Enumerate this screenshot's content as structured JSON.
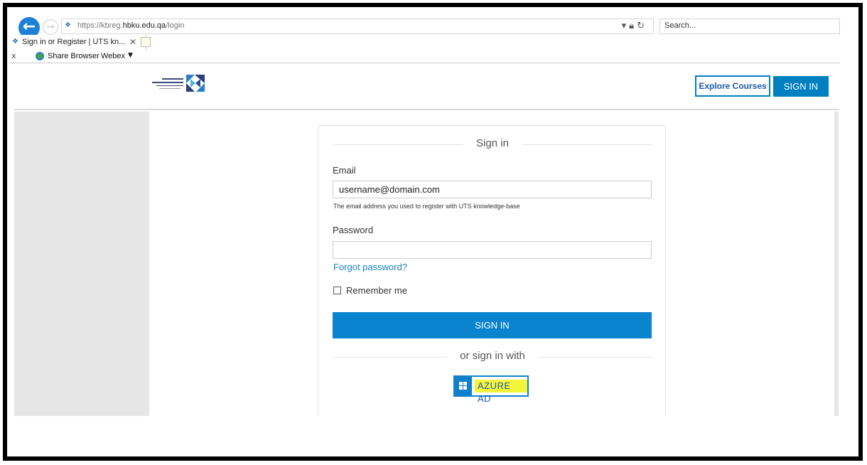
{
  "browser": {
    "url_prefix": "https://kbreg.",
    "url_host": "hbku.edu.qa",
    "url_path": "/login",
    "search_placeholder": "Search...",
    "tab_title": "Sign in or Register | UTS kn...",
    "favorites": {
      "close_glyph": "x",
      "share_browser": "Share Browser",
      "webex": "Webex"
    }
  },
  "header": {
    "explore_courses": "Explore Courses",
    "sign_in": "SIGN IN"
  },
  "form": {
    "title": "Sign in",
    "email_label": "Email",
    "email_value": "username@domain.com",
    "email_help": "The email address you used to register with UTS knowledge-base",
    "password_label": "Password",
    "password_value": "",
    "forgot_password": "Forgot password?",
    "remember_me": "Remember me",
    "submit": "SIGN IN",
    "alt_signin": "or sign in with",
    "azure_ad": "AZURE AD"
  },
  "colors": {
    "primary": "#0b84cf",
    "link": "#1a84c8",
    "highlight": "#f4f43a",
    "side_panel": "#e6e6e6"
  },
  "icons": [
    "back-arrow-icon",
    "forward-arrow-icon",
    "site-favicon-icon",
    "lock-icon",
    "refresh-icon",
    "tab-close-icon",
    "new-tab-icon",
    "share-browser-icon",
    "dropdown-caret-icon",
    "windows-logo-icon"
  ]
}
